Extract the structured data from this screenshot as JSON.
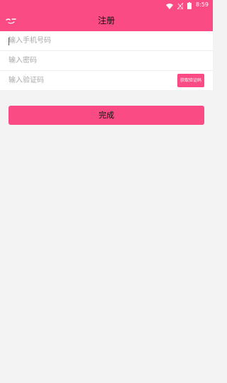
{
  "status_bar": {
    "time": "8:59",
    "icons": [
      "wifi-icon",
      "signal-off-icon",
      "battery-icon"
    ]
  },
  "header": {
    "title": "注册",
    "back_icon": "back-icon"
  },
  "form": {
    "phone": {
      "placeholder": "输入手机号码",
      "value": ""
    },
    "password": {
      "placeholder": "输入密码",
      "value": ""
    },
    "code": {
      "placeholder": "输入验证码",
      "value": ""
    },
    "get_code_label": "获取验证码"
  },
  "submit": {
    "label": "完成"
  },
  "colors": {
    "accent": "#fb4b84",
    "background": "#f3f3f3",
    "card": "#ffffff",
    "placeholder": "#a9a9a9"
  }
}
